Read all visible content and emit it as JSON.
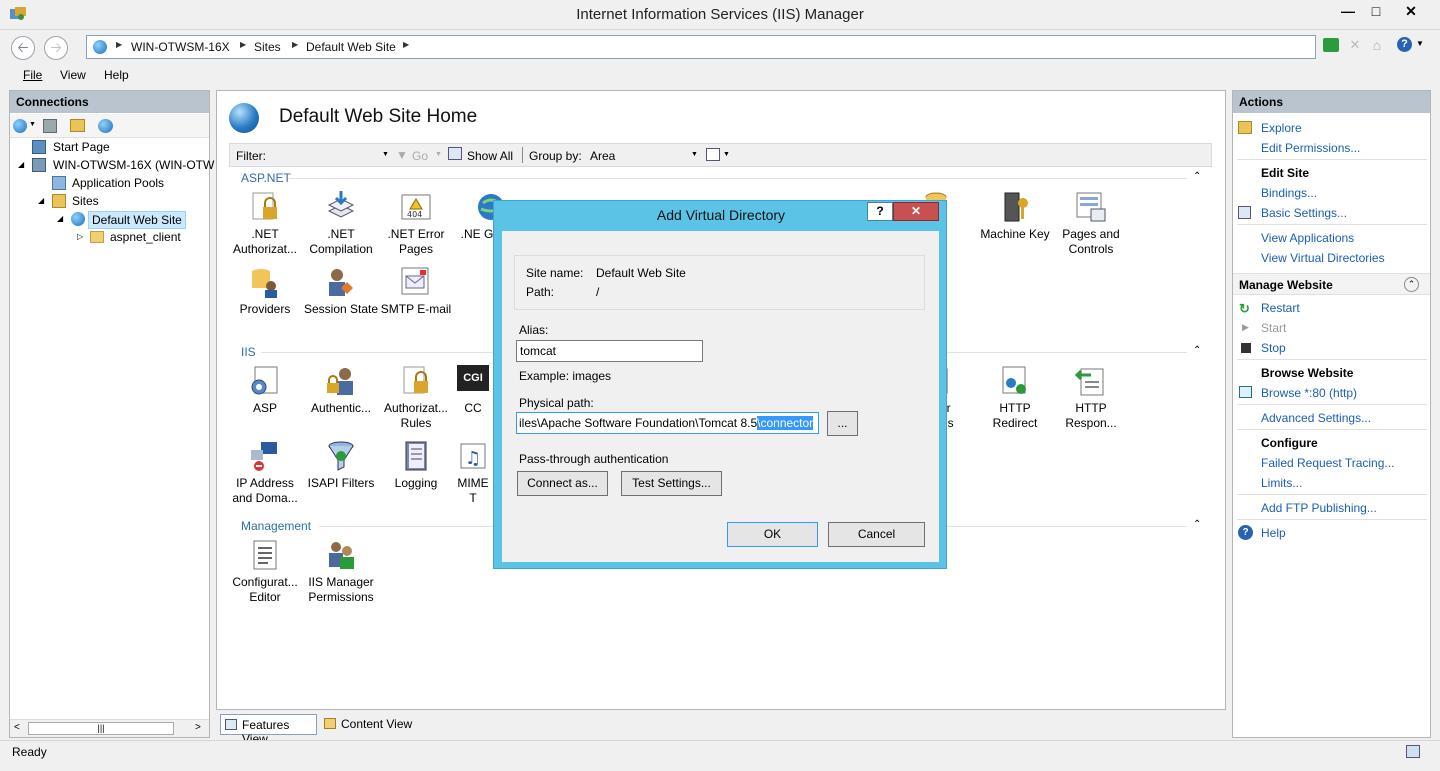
{
  "window": {
    "title": "Internet Information Services (IIS) Manager"
  },
  "address": {
    "crumbs": [
      "WIN-OTWSM-16X",
      "Sites",
      "Default Web Site"
    ]
  },
  "menu": {
    "file": "File",
    "view": "View",
    "help": "Help"
  },
  "connections": {
    "header": "Connections",
    "tree": {
      "start_page": "Start Page",
      "server": "WIN-OTWSM-16X (WIN-OTW",
      "app_pools": "Application Pools",
      "sites": "Sites",
      "default_site": "Default Web Site",
      "aspnet_client": "aspnet_client"
    }
  },
  "main": {
    "title": "Default Web Site Home",
    "filter_label": "Filter:",
    "go_label": "Go",
    "show_all": "Show All",
    "group_by_label": "Group by:",
    "group_by_value": "Area",
    "groups": {
      "aspnet": "ASP.NET",
      "iis": "IIS",
      "management": "Management"
    },
    "features": {
      "net_auth": ".NET Authorizat...",
      "net_compile": ".NET Compilation",
      "net_error": ".NET Error Pages",
      "net_glob": ".NE Globali",
      "connection_strings": "ction ngs",
      "machine_key": "Machine Key",
      "pages_controls": "Pages and Controls",
      "providers": "Providers",
      "session_state": "Session State",
      "smtp": "SMTP E-mail",
      "asp": "ASP",
      "authentication": "Authentic...",
      "authorization": "Authorizat... Rules",
      "cgi": "CC",
      "handler": "ler ngs",
      "http_redirect": "HTTP Redirect",
      "http_response": "HTTP Respon...",
      "ip_address": "IP Address and Doma...",
      "isapi": "ISAPI Filters",
      "logging": "Logging",
      "mime": "MIME T",
      "config_editor": "Configurat... Editor",
      "iis_mgr_perm": "IIS Manager Permissions"
    }
  },
  "actions": {
    "header": "Actions",
    "explore": "Explore",
    "edit_permissions": "Edit Permissions...",
    "edit_site": "Edit Site",
    "bindings": "Bindings...",
    "basic_settings": "Basic Settings...",
    "view_applications": "View Applications",
    "view_vdirs": "View Virtual Directories",
    "manage_website": "Manage Website",
    "restart": "Restart",
    "start": "Start",
    "stop": "Stop",
    "browse_website": "Browse Website",
    "browse_80": "Browse *:80 (http)",
    "advanced_settings": "Advanced Settings...",
    "configure": "Configure",
    "failed_tracing": "Failed Request Tracing...",
    "limits": "Limits...",
    "add_ftp": "Add FTP Publishing...",
    "help": "Help"
  },
  "bottom": {
    "features_view": "Features View",
    "content_view": "Content View"
  },
  "status": {
    "text": "Ready"
  },
  "dialog": {
    "title": "Add Virtual Directory",
    "help_btn": "?",
    "close_btn": "✕",
    "site_name_label": "Site name:",
    "site_name_value": "Default Web Site",
    "path_label": "Path:",
    "path_value": "/",
    "alias_label": "Alias:",
    "alias_value": "tomcat",
    "example": "Example: images",
    "physical_label": "Physical path:",
    "physical_value_plain": "iles\\Apache Software Foundation\\Tomcat 8.5",
    "physical_value_selected": "\\connector",
    "browse_btn": "...",
    "pass_through": "Pass-through authentication",
    "connect_as": "Connect as...",
    "test_settings": "Test Settings...",
    "ok": "OK",
    "cancel": "Cancel"
  }
}
